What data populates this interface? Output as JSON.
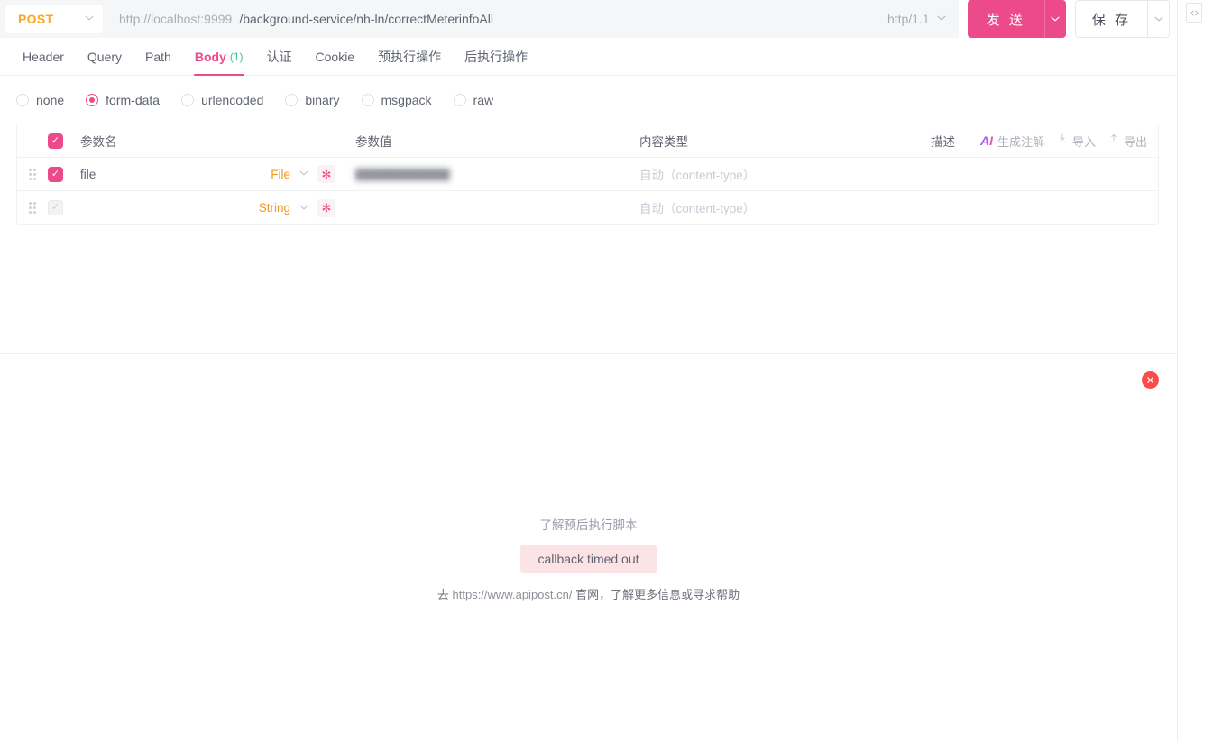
{
  "request": {
    "method": "POST",
    "url_host": "http://localhost:9999",
    "url_path": "/background-service/nh-ln/correctMeterinfoAll",
    "protocol": "http/1.1",
    "send_label": "发 送",
    "save_label": "保 存"
  },
  "rail": {
    "code_icon": "◌"
  },
  "tabs": [
    {
      "label": "Header",
      "count": ""
    },
    {
      "label": "Query",
      "count": ""
    },
    {
      "label": "Path",
      "count": ""
    },
    {
      "label": "Body",
      "count": "(1)"
    },
    {
      "label": "认证",
      "count": ""
    },
    {
      "label": "Cookie",
      "count": ""
    },
    {
      "label": "预执行操作",
      "count": ""
    },
    {
      "label": "后执行操作",
      "count": ""
    }
  ],
  "body_types": [
    {
      "label": "none",
      "selected": false
    },
    {
      "label": "form-data",
      "selected": true
    },
    {
      "label": "urlencoded",
      "selected": false
    },
    {
      "label": "binary",
      "selected": false
    },
    {
      "label": "msgpack",
      "selected": false
    },
    {
      "label": "raw",
      "selected": false
    }
  ],
  "table": {
    "headers": {
      "name": "参数名",
      "value": "参数值",
      "content_type": "内容类型",
      "description": "描述"
    },
    "actions": {
      "ai_glyph": "AI",
      "ai_label": "生成注解",
      "import_label": "导入",
      "export_label": "导出"
    },
    "rows": [
      {
        "checked": true,
        "name": "file",
        "name_placeholder": "",
        "type": "File",
        "value": "▇▇▇▇▇▇▇▇▇▇",
        "value_blurred": true,
        "content_type_placeholder": "自动（content-type）",
        "description_placeholder": ""
      },
      {
        "checked": false,
        "name": "",
        "name_placeholder": "",
        "type": "String",
        "value": "",
        "value_blurred": false,
        "content_type_placeholder": "自动（content-type）",
        "description_placeholder": ""
      }
    ]
  },
  "response": {
    "close_icon": "✕",
    "empty_title": "了解预后执行脚本",
    "status_badge": "callback timed out",
    "footer_prefix": "去 ",
    "footer_link": "https://www.apipost.cn/",
    "footer_suffix": " 官网，了解更多信息或寻求帮助"
  },
  "colors": {
    "accent_pink": "#ec4a8a",
    "method_orange": "#f9a825",
    "type_orange": "#f5961e",
    "count_green": "#3dc08a",
    "close_red": "#fb4b4b"
  }
}
